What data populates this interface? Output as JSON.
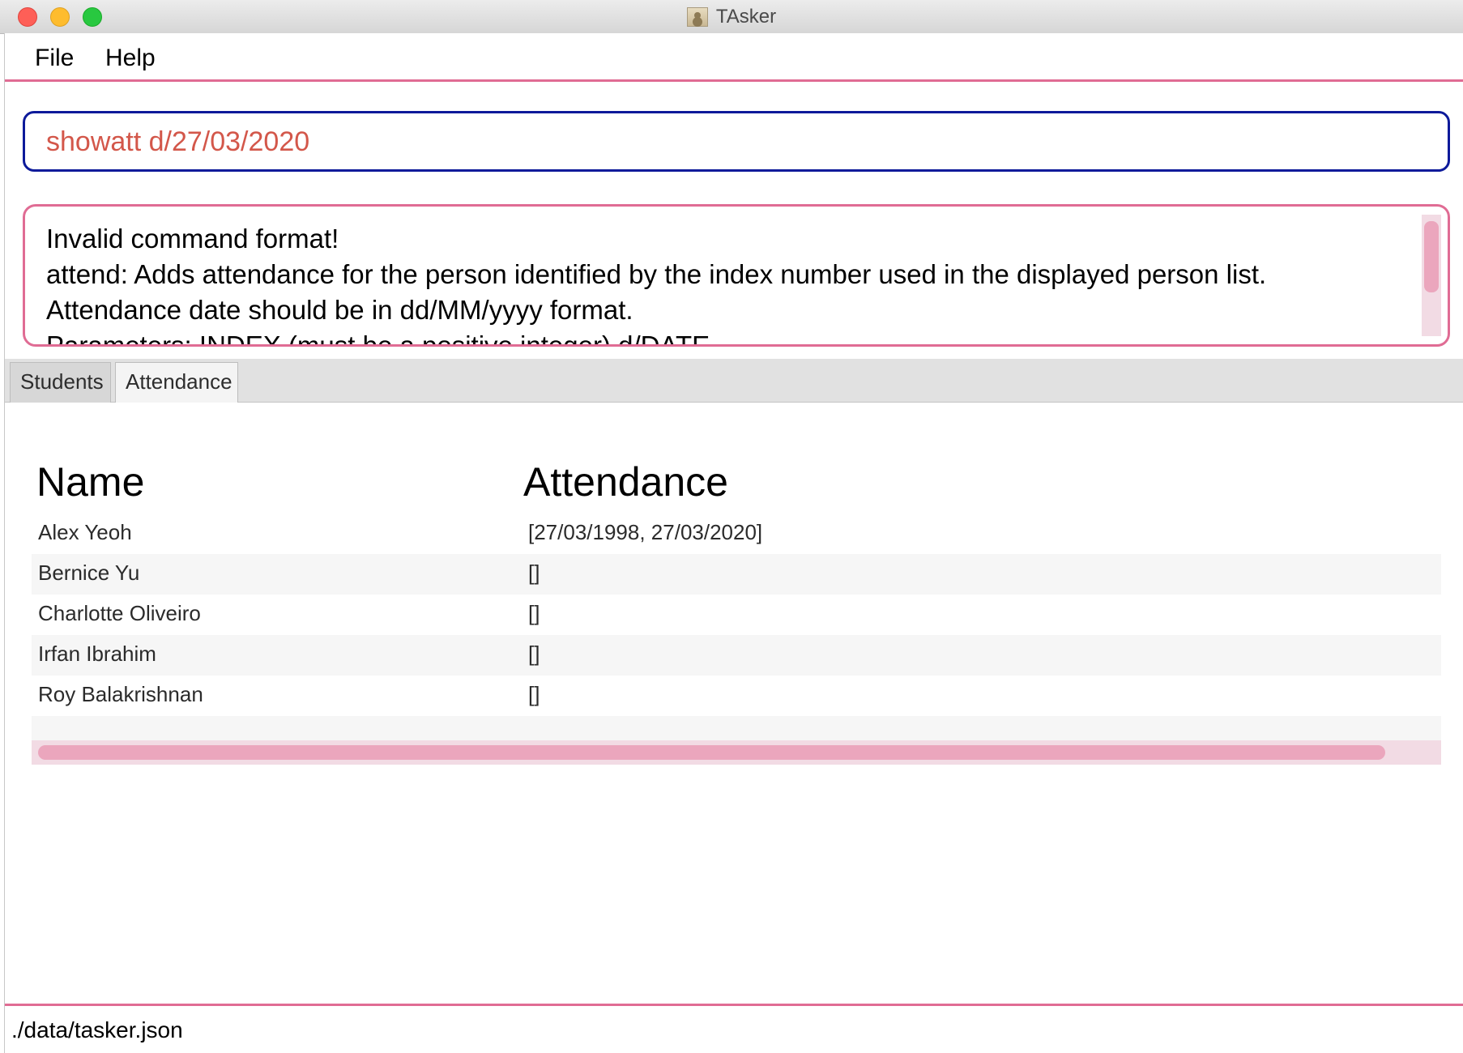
{
  "window": {
    "title": "TAsker"
  },
  "menu": {
    "file": "File",
    "help": "Help"
  },
  "command": {
    "value": "showatt d/27/03/2020"
  },
  "result": {
    "lines": [
      "Invalid command format!",
      "attend: Adds attendance for the person identified by the index number used in the displayed person list.",
      "Attendance date should be in dd/MM/yyyy format.",
      "Parameters: INDEX (must be a positive integer) d/DATE"
    ]
  },
  "tabs": {
    "students": "Students",
    "attendance": "Attendance"
  },
  "table": {
    "headers": {
      "name": "Name",
      "attendance": "Attendance"
    },
    "rows": [
      {
        "name": "Alex Yeoh",
        "attendance": "[27/03/1998, 27/03/2020]"
      },
      {
        "name": "Bernice Yu",
        "attendance": "[]"
      },
      {
        "name": "Charlotte Oliveiro",
        "attendance": "[]"
      },
      {
        "name": "Irfan Ibrahim",
        "attendance": "[]"
      },
      {
        "name": "Roy Balakrishnan",
        "attendance": "[]"
      }
    ]
  },
  "status": {
    "path": "./data/tasker.json"
  },
  "colors": {
    "accent_pink": "#e06c94",
    "command_border": "#0d1a9a",
    "command_text": "#d3574a"
  }
}
